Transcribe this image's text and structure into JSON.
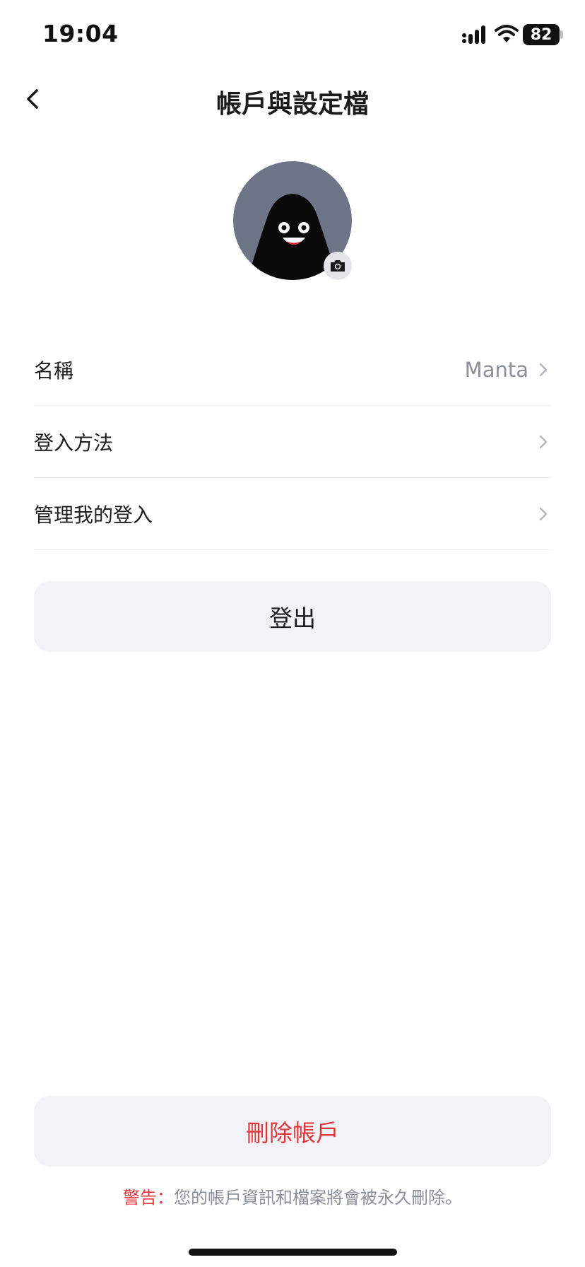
{
  "status_bar": {
    "time": "19:04",
    "battery": "82"
  },
  "header": {
    "title": "帳戶與設定檔"
  },
  "settings": {
    "items": [
      {
        "label": "名稱",
        "value": "Manta"
      },
      {
        "label": "登入方法",
        "value": ""
      },
      {
        "label": "管理我的登入",
        "value": ""
      }
    ]
  },
  "actions": {
    "logout_label": "登出",
    "delete_label": "刪除帳戶"
  },
  "warning": {
    "label": "警告：",
    "text": "您的帳戶資訊和檔案將會被永久刪除。"
  },
  "colors": {
    "danger": "#e0353b",
    "secondary_text": "#8a8f99",
    "button_bg": "#f2f3f6",
    "avatar_bg": "#6e7587"
  },
  "icons": [
    "back-chevron-icon",
    "camera-icon",
    "chevron-right-icon",
    "signal-icon",
    "wifi-icon",
    "battery-icon"
  ]
}
